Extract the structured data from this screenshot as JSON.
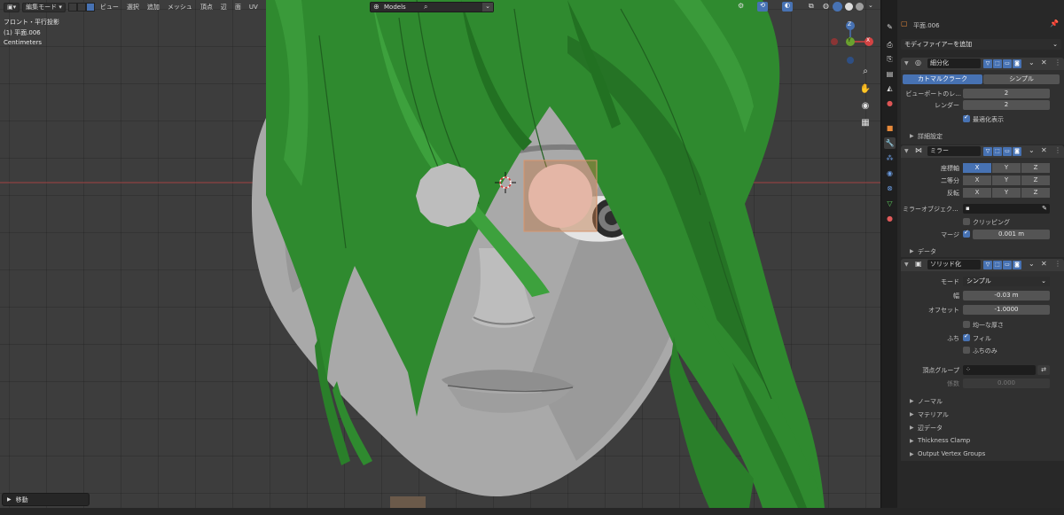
{
  "viewport": {
    "mode_label": "編集モード",
    "menu": [
      "ビュー",
      "選択",
      "追加",
      "メッシュ",
      "頂点",
      "辺",
      "面",
      "UV"
    ],
    "transform_orientation": "Models",
    "overlay_text": {
      "view_name": "フロント・平行投影",
      "object_name": "(1) 平面.006",
      "units": "Centimeters"
    },
    "last_operator": "移動",
    "gizmo": {
      "z": "Z",
      "y": "Y",
      "x": "X"
    }
  },
  "colors": {
    "hair": "#2f8a2f",
    "skin": "#b2b2b2",
    "accent": "#4772b3",
    "selection": "#d9956b"
  },
  "properties": {
    "object_name": "平面.006",
    "add_modifier": "モディファイアーを追加",
    "subdivision": {
      "name": "細分化",
      "tab_catmull": "カトマルクラーク",
      "tab_simple": "シンプル",
      "viewport_label": "ビューポートのレ...",
      "viewport_value": "2",
      "render_label": "レンダー",
      "render_value": "2",
      "optimal_label": "最適化表示",
      "advanced_label": "詳細設定"
    },
    "mirror": {
      "name": "ミラー",
      "axis_label": "座標軸",
      "bisect_label": "二等分",
      "flip_label": "反転",
      "x": "X",
      "y": "Y",
      "z": "Z",
      "mirror_object_label": "ミラーオブジェク...",
      "clipping_label": "クリッピング",
      "merge_label": "マージ",
      "merge_value": "0.001 m",
      "data_label": "データ"
    },
    "solidify": {
      "name": "ソリッド化",
      "mode_label": "モード",
      "mode_value": "シンプル",
      "thickness_label": "幅",
      "thickness_value": "-0.03 m",
      "offset_label": "オフセット",
      "offset_value": "-1.0000",
      "even_label": "均一な厚さ",
      "rim_label": "ふち",
      "fill_label": "フィル",
      "rim_only_label": "ふちのみ",
      "vgroup_label": "頂点グループ",
      "factor_label": "係数",
      "factor_value": "0.000",
      "subpanels": [
        "ノーマル",
        "マテリアル",
        "辺データ",
        "Thickness Clamp",
        "Output Vertex Groups"
      ]
    }
  }
}
